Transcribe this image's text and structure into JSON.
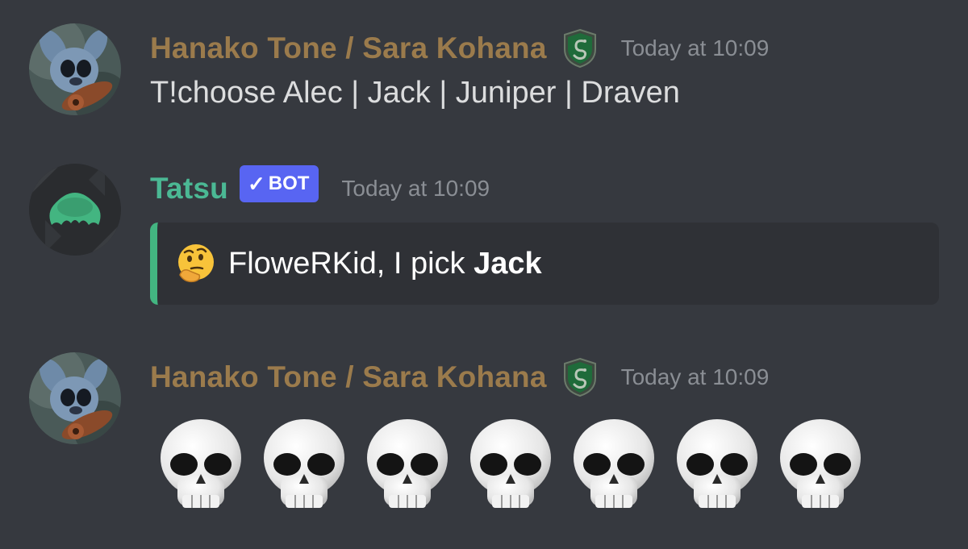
{
  "messages": [
    {
      "author": "Hanako Tone / Sara Kohana",
      "role_icon": "slytherin-crest-icon",
      "timestamp": "Today at 10:09",
      "content": "T!choose Alec | Jack | Juniper | Draven"
    },
    {
      "author": "Tatsu",
      "bot_tag": "BOT",
      "bot_check": "✓",
      "timestamp": "Today at 10:09",
      "embed": {
        "emoji": "thinking-face-icon",
        "text_prefix": "FloweRKid, I pick ",
        "text_bold": "Jack",
        "accent_color": "#43b581"
      }
    },
    {
      "author": "Hanako Tone / Sara Kohana",
      "role_icon": "slytherin-crest-icon",
      "timestamp": "Today at 10:09",
      "emoji_count": 7,
      "emoji": "skull-icon"
    }
  ],
  "colors": {
    "background": "#36393f",
    "user_name": "#9b7b4c",
    "bot_name": "#4bb894",
    "bot_tag": "#5865f2",
    "timestamp": "#8a8e94",
    "text": "#dcddde"
  }
}
